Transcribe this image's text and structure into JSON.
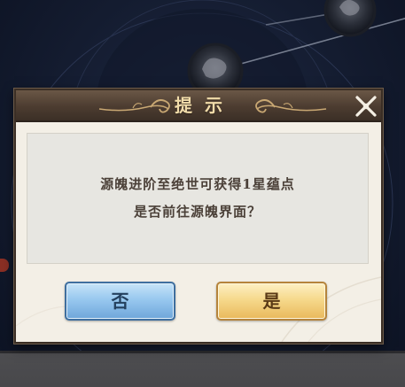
{
  "dialog": {
    "title": "提示",
    "message_line1": "源魄进阶至绝世可获得1星蕴点",
    "message_line2": "是否前往源魄界面？",
    "no_label": "否",
    "yes_label": "是"
  },
  "icons": {
    "close": "close-icon",
    "title_ornament": "swirl-ornament-icon",
    "constellation_node": "dragon-emblem-icon"
  },
  "colors": {
    "background": "#141c30",
    "title_bar": "#4c3c30",
    "title_text": "#f1dcaa",
    "dialog_body": "#f3efe6",
    "message_panel": "#e7e6e1",
    "no_button": "#98c8ef",
    "yes_button": "#f6d98c"
  }
}
